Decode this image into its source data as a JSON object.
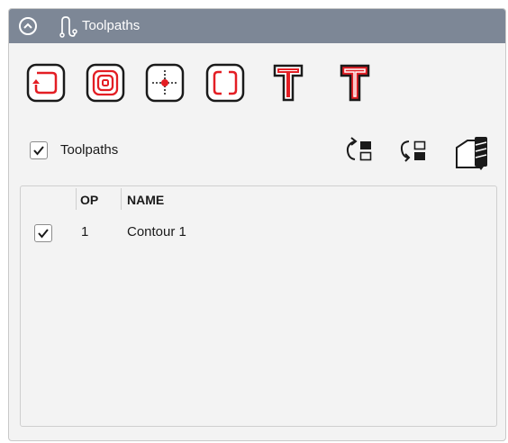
{
  "panel": {
    "title": "Toolpaths",
    "collapse_icon": "chevron-up-circle-icon",
    "title_icon": "toolpath-icon"
  },
  "tools": [
    {
      "name": "pocket-start-tool-icon"
    },
    {
      "name": "pocket-spiral-tool-icon"
    },
    {
      "name": "drill-point-tool-icon"
    },
    {
      "name": "profile-tabs-tool-icon"
    },
    {
      "name": "text-outline-tool-icon"
    },
    {
      "name": "text-engrave-tool-icon"
    }
  ],
  "show_toolpaths": {
    "label": "Toolpaths",
    "checked": true
  },
  "actions": [
    {
      "name": "reorder-up-icon"
    },
    {
      "name": "reorder-down-icon"
    },
    {
      "name": "simulate-tool-icon"
    }
  ],
  "table": {
    "columns": [
      "OP",
      "NAME"
    ],
    "rows": [
      {
        "checked": true,
        "op": "1",
        "name": "Contour 1"
      }
    ]
  },
  "colors": {
    "titlebar": "#7d8796",
    "accent_red": "#e31e24",
    "panel_bg": "#f3f3f3"
  }
}
